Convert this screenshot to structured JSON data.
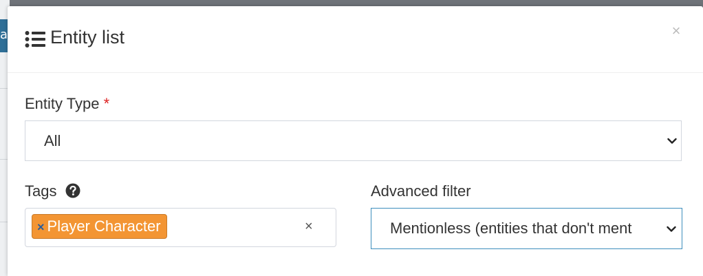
{
  "background": {
    "partial_text": "a"
  },
  "modal": {
    "icon": "list-icon",
    "title": "Entity list",
    "close_label": "×"
  },
  "entity_type": {
    "label": "Entity Type",
    "required_marker": "*",
    "selected": "All"
  },
  "tags": {
    "label": "Tags",
    "help_icon": "question-circle-icon",
    "chips": [
      {
        "remove_label": "×",
        "label": "Player Character"
      }
    ],
    "clear_label": "×"
  },
  "advanced_filter": {
    "label": "Advanced filter",
    "selected": "Mentionless (entities that don't ment"
  },
  "colors": {
    "tag_chip": "#f39533",
    "tag_remove": "#2a5d9c",
    "required": "#dd2222",
    "active_border": "#3c8dbc"
  }
}
